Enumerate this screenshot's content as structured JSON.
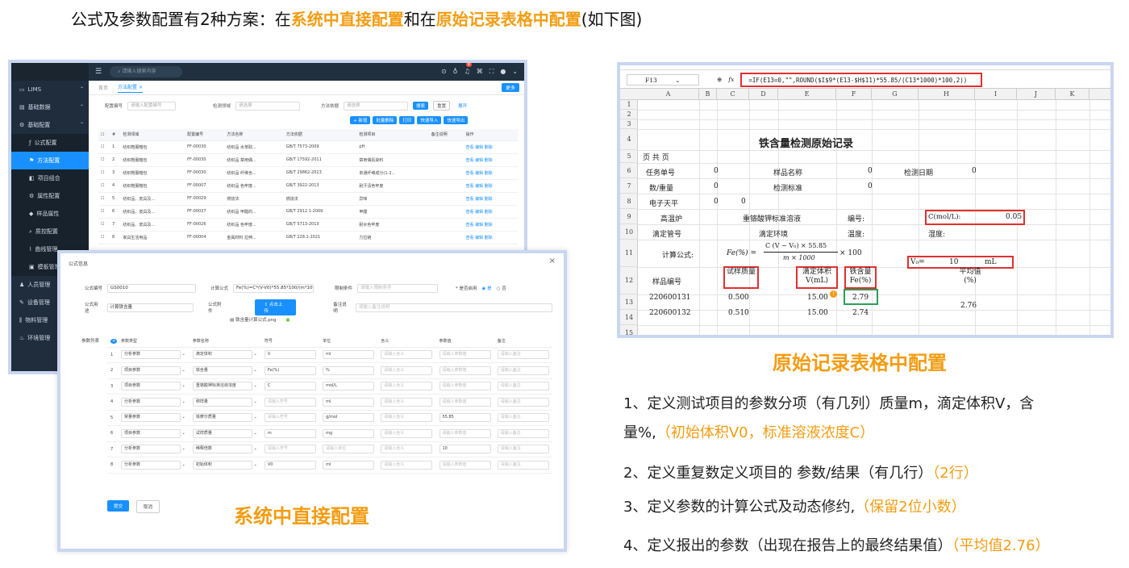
{
  "headline": {
    "p1": "公式及参数配置有2种方案：在",
    "h1": "系统中直接配置",
    "p2": "和在",
    "h2": "原始记录表格中配置",
    "p3": "(如下图)"
  },
  "app": {
    "topbar": {
      "search_placeholder": "请输入搜索内容",
      "badge": "9"
    },
    "sidebar": [
      {
        "label": "LIMS",
        "icon": "monitor-icon"
      },
      {
        "label": "基础数据",
        "icon": "book-icon"
      },
      {
        "label": "基础配置",
        "icon": "gear-icon"
      },
      {
        "label": "公式配置",
        "icon": "function-icon",
        "sub": true
      },
      {
        "label": "方法配置",
        "icon": "flag-icon",
        "sub": true,
        "active": true
      },
      {
        "label": "项目组合",
        "icon": "combine-icon",
        "sub": true
      },
      {
        "label": "属性配置",
        "icon": "gear-icon",
        "sub": true
      },
      {
        "label": "样品属性",
        "icon": "tag-icon",
        "sub": true
      },
      {
        "label": "质控配置",
        "icon": "search-icon",
        "sub": true
      },
      {
        "label": "曲线管理",
        "icon": "chart-icon",
        "sub": true
      },
      {
        "label": "模板管理",
        "icon": "template-icon",
        "sub": true
      },
      {
        "label": "人员管理",
        "icon": "user-icon"
      },
      {
        "label": "设备管理",
        "icon": "wrench-icon"
      },
      {
        "label": "物料管理",
        "icon": "bar-icon"
      },
      {
        "label": "环境管理",
        "icon": "thermo-icon"
      }
    ],
    "tabs": {
      "home": "首页",
      "current": "方法配置",
      "more": "更多"
    },
    "filters": {
      "l1": "配置编号",
      "p1": "请输入配置编号",
      "l2": "检测领域",
      "p2": "请选择",
      "l3": "方法依据",
      "p3": "请选择",
      "search": "搜索",
      "reset": "重置",
      "expand": "展开"
    },
    "actions": [
      "+ 新增",
      "批量删除",
      "打印",
      "快速导入",
      "快速导出"
    ],
    "columns": [
      "#",
      "检测领域",
      "配置编号",
      "方法名称",
      "方法依据",
      "检测项目",
      "备注说明",
      "操作"
    ],
    "rows": [
      [
        "1",
        "纺织鞋服箱包",
        "FF-00030",
        "纺织品 水萃取...",
        "GB/T 7573-2009",
        "pH"
      ],
      [
        "2",
        "纺织鞋服箱包",
        "FF-00030",
        "纺织品 禁用偶...",
        "GB/T 17592-2011",
        "禁用偶氮染料"
      ],
      [
        "3",
        "纺织鞋服箱包",
        "FF-00030",
        "纺织品 纤维含...",
        "GB/T 29862-2013",
        "单通纤维成分(1-2..."
      ],
      [
        "4",
        "纺织鞋服箱包",
        "FF-00007",
        "纺织品 色牢度...",
        "GB/T 3922-2013",
        "耐汗渍色牢度"
      ],
      [
        "5",
        "纺织品、皮具及...",
        "FF-00029",
        "燃烧法",
        "燃烧法",
        "异味"
      ],
      [
        "6",
        "纺织品、皮具及...",
        "FF-00037",
        "纺织品 甲醛的...",
        "GB/T 2912.1-2009",
        "甲醛"
      ],
      [
        "7",
        "纺织品、皮具及...",
        "FF-00026",
        "纺织品 色牢度...",
        "GB/T 5713-2013",
        "耐水色牢度"
      ],
      [
        "8",
        "家具生活用品",
        "FF-00004",
        "金属材料 拉伸...",
        "GB/T 228.1-2021",
        "力拉链"
      ]
    ],
    "row_ops": "查看  编辑  删除"
  },
  "modal": {
    "title": "公式信息",
    "f_code_label": "公式编号",
    "f_code": "GS0010",
    "f_calc_label": "计算公式",
    "f_calc": "Fe(%)=C*(V-V0)*55.85*100/(m*1000",
    "f_limit_label": "限制条件",
    "f_limit_ph": "请输入限制条件",
    "f_enable_label": "* 是否启用",
    "f_yes": "是",
    "f_no": "否",
    "f_use_label": "公式用途",
    "f_use": "计算铁含量",
    "f_attach_label": "公式附件",
    "f_upload": "点击上传",
    "f_file": "铁含量计算公式.png",
    "f_note_label": "备注说明",
    "f_note_ph": "请输入备注说明",
    "plist_label": "参数列表",
    "pcols": [
      "参数类型",
      "参数名称",
      "符号",
      "单位",
      "含义",
      "参数值",
      "备注"
    ],
    "prows": [
      [
        "1",
        "分析参数",
        "滴定体积",
        "V",
        "ml",
        "请输入含义",
        "请输入参数值",
        "请输入备注"
      ],
      [
        "2",
        "项目参数",
        "铁含量",
        "Fe(%)",
        "%",
        "请输入含义",
        "请输入参数值",
        "请输入备注"
      ],
      [
        "3",
        "项目参数",
        "重铬酸钾标准溶液浓度",
        "C",
        "mol/L",
        "请输入含义",
        "请输入参数值",
        "请输入备注"
      ],
      [
        "4",
        "分析参数",
        "称样量",
        "请输入符号",
        "ml",
        "请输入含义",
        "请输入参数值",
        "请输入备注"
      ],
      [
        "5",
        "常量参数",
        "铁摩尔质量",
        "请输入符号",
        "g/mol",
        "请输入含义",
        "55.85",
        "请输入备注"
      ],
      [
        "6",
        "项目参数",
        "试样质量",
        "m",
        "mg",
        "请输入含义",
        "请输入参数值",
        "请输入备注"
      ],
      [
        "7",
        "分析参数",
        "稀释倍数",
        "请输入符号",
        "请输入单位",
        "请输入含义",
        "10",
        "请输入备注"
      ],
      [
        "8",
        "分析参数",
        "初始体积",
        "V0",
        "ml",
        "请输入含义",
        "请输入参数值",
        "请输入备注"
      ]
    ],
    "submit": "提交",
    "cancel": "取消"
  },
  "caption_left": "系统中直接配置",
  "sheet": {
    "cellref": "F13",
    "fx": "fx",
    "formula": "=IF(E13=0,\"\",ROUND($I$9*(E13-$H$11)*55.85/(C13*1000)*100,2))",
    "cols": [
      "A",
      "B",
      "C",
      "D",
      "E",
      "F",
      "G",
      "H",
      "I",
      "J",
      "K"
    ],
    "rows": [
      "1",
      "2",
      "3",
      "4",
      "5",
      "6",
      "7",
      "8",
      "9",
      "10",
      "11",
      "12",
      "13",
      "14",
      "15"
    ],
    "title": "铁含量检测原始记录",
    "page": "页 共  页",
    "task": "任务单号",
    "task_v": "0",
    "sample_name": "样品名称",
    "sample_name_v": "0",
    "det_date": "检测日期",
    "det_date_v": "0",
    "mass": "数/重量",
    "mass_v": "0",
    "std": "检测标准",
    "std_v": "0",
    "balance": "电子天平",
    "balance_v1": "0",
    "balance_v2": "0",
    "furnace": "高温炉",
    "solution": "重铬酸钾标准溶液",
    "serial": "编号:",
    "conc": "C(mol/L):",
    "conc_v": "0.05",
    "burette": "滴定管号",
    "env": "滴定环境",
    "temp": "温度:",
    "humid": "湿度:",
    "calc": "计算公式:",
    "eq": "Fe(%) =",
    "eq_num": "C (V − V₀) × 55.85",
    "eq_den": "m × 1000",
    "eq_tail": "× 100",
    "v0": "V₀=",
    "v0_v": "10",
    "v0_u": "mL",
    "h_sample": "样品编号",
    "h_mass": "试样质量",
    "h_vol": "滴定体积 V(mL)",
    "h_fe": "铁含量 Fe(%)",
    "h_avg": "平均值 (%)",
    "r1": [
      "220600131",
      "0.500",
      "15.00",
      "2.79"
    ],
    "r2": [
      "220600132",
      "0.510",
      "15.00",
      "2.74"
    ],
    "avg": "2.76"
  },
  "caption_right": "原始记录表格中配置",
  "list": {
    "l1a": "1、定义测试项目的参数分项（有几列）质量m，滴定体积V，含",
    "l1b": "量%,",
    "l1c": "（初始体积V0，标准溶液浓度C）",
    "l2a": "2、定义重复数定义项目的 参数/结果（有几行）",
    "l2b": "（2行）",
    "l3a": "3、定义参数的计算公式及动态修约,",
    "l3b": "（保留2位小数）",
    "l4a": "4、定义报出的参数（出现在报告上的最终结果值）",
    "l4b": "（平均值2.76）"
  }
}
